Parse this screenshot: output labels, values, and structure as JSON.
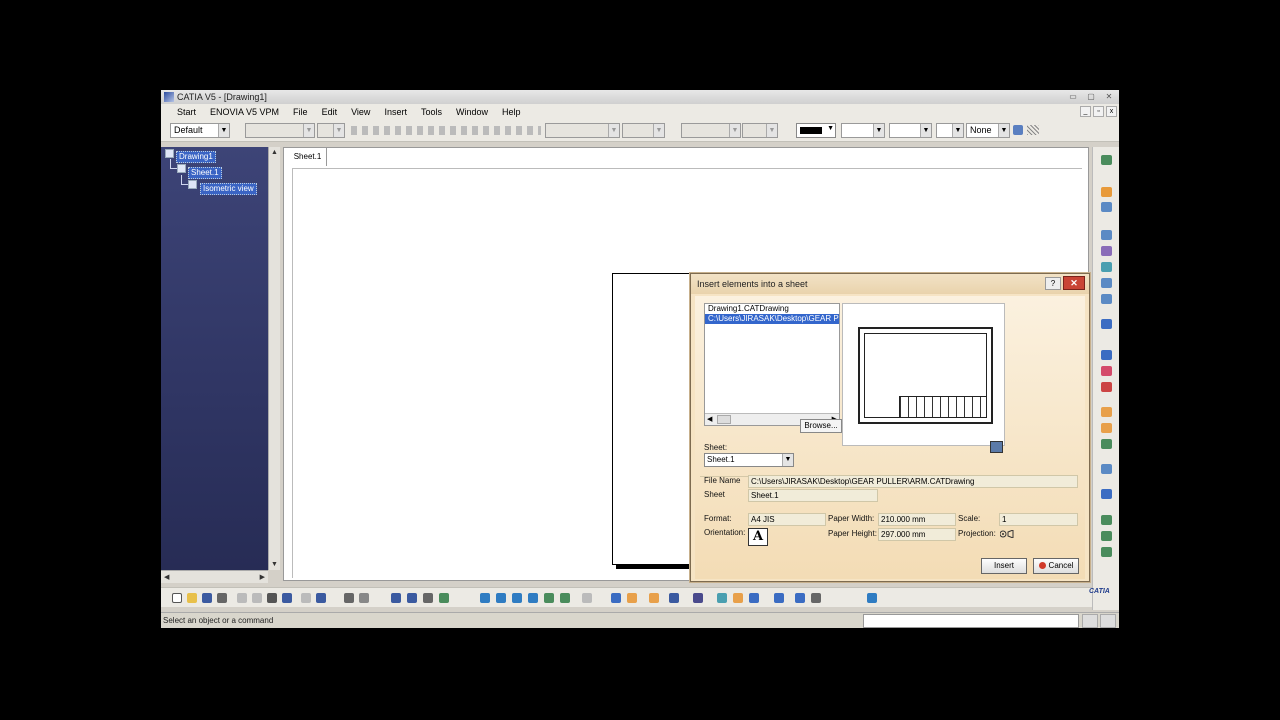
{
  "window": {
    "title": "CATIA V5 - [Drawing1]",
    "controls": [
      "▭",
      "▢",
      "✕"
    ]
  },
  "menu": {
    "items": [
      "Start",
      "ENOVIA V5 VPM",
      "File",
      "Edit",
      "View",
      "Insert",
      "Tools",
      "Window",
      "Help"
    ],
    "doc_controls": [
      "_",
      "▫",
      "x"
    ]
  },
  "toolbar": {
    "style_select": "Default",
    "linetype_value": "None"
  },
  "tree": {
    "root": "Drawing1",
    "sheet": "Sheet.1",
    "view": "Isometric view"
  },
  "canvas": {
    "sheet_tab": "Sheet.1"
  },
  "status": {
    "message": "Select an object or a command"
  },
  "brand": {
    "logo_text": "CATIA"
  },
  "dialog": {
    "title": "Insert elements into a sheet",
    "help": "?",
    "close": "✕",
    "files": [
      "Drawing1.CATDrawing",
      "C:\\Users\\JIRASAK\\Desktop\\GEAR P"
    ],
    "browse_label": "Browse...",
    "sheet_label": "Sheet:",
    "sheet_value": "Sheet.1",
    "file_name_label": "File Name",
    "file_name_value": "C:\\Users\\JIRASAK\\Desktop\\GEAR PULLER\\ARM.CATDrawing",
    "sheet2_label": "Sheet",
    "sheet2_value": "Sheet.1",
    "format_label": "Format:",
    "format_value": "A4 JIS",
    "paper_width_label": "Paper Width:",
    "paper_width_value": "210.000 mm",
    "scale_label": "Scale:",
    "scale_value": "1",
    "orientation_label": "Orientation:",
    "orientation_value": "A",
    "paper_height_label": "Paper Height:",
    "paper_height_value": "297.000 mm",
    "projection_label": "Projection:",
    "insert_label": "Insert",
    "cancel_label": "Cancel"
  }
}
